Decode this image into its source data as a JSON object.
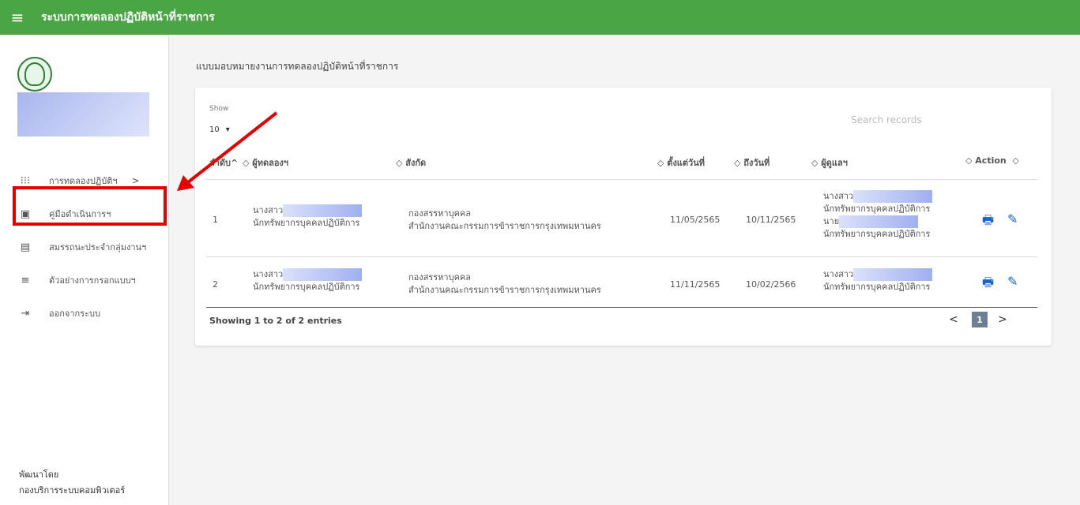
{
  "header": {
    "menu_icon": "hamburger-icon",
    "title": "ระบบการทดลองปฏิบัติหน้าที่ราชการ"
  },
  "sidebar": {
    "items": [
      {
        "label": "การทดลองปฏิบัติฯ",
        "icon": "grid-icon",
        "chevron": ">"
      },
      {
        "label": "คู่มือดำเนินการฯ",
        "icon": "wallet-icon"
      },
      {
        "label": "สมรรถนะประจำกลุ่มงานฯ",
        "icon": "document-icon"
      },
      {
        "label": "ตัวอย่างการกรอกแบบฯ",
        "icon": "list-icon"
      },
      {
        "label": "ออกจากระบบ",
        "icon": "logout-icon"
      }
    ],
    "footer": {
      "line1": "พัฒนาโดย",
      "line2": "กองบริการระบบคอมพิวเตอร์"
    }
  },
  "main": {
    "subtitle": "แบบมอบหมายงานการทดลองปฏิบัติหน้าที่ราชการ",
    "show_label": "Show",
    "show_value": "10",
    "search_placeholder": "Search records",
    "columns": [
      "ลำดับ^",
      "ผู้ทดลองฯ",
      "สังกัด",
      "ตั้งแต่วันที่",
      "ถึงวันที่",
      "ผู้ดูแลฯ",
      "Action"
    ],
    "rows": [
      {
        "no": "1",
        "trainee_prefix": "นางสาว",
        "trainee_title": "นักทรัพยากรบุคคลปฏิบัติการ",
        "dept_1": "กองสรรหาบุคคล",
        "dept_2": "สำนักงานคณะกรรมการข้าราชการกรุงเทพมหานคร",
        "from": "11/05/2565",
        "to": "10/11/2565",
        "mentors": [
          {
            "prefix": "นางสาว",
            "title": "นักทรัพยากรบุคคลปฏิบัติการ"
          },
          {
            "prefix": "นาย",
            "title": "นักทรัพยากรบุคคลปฏิบัติการ"
          }
        ]
      },
      {
        "no": "2",
        "trainee_prefix": "นางสาว",
        "trainee_title": "นักทรัพยากรบุคคลปฏิบัติการ",
        "dept_1": "กองสรรหาบุคคล",
        "dept_2": "สำนักงานคณะกรรมการข้าราชการกรุงเทพมหานคร",
        "from": "11/11/2565",
        "to": "10/02/2566",
        "mentors": [
          {
            "prefix": "นางสาว",
            "title": "นักทรัพยากรบุคคลปฏิบัติการ"
          }
        ]
      }
    ],
    "entries_text": "Showing 1 to 2 of 2 entries",
    "pagination": {
      "prev": "<",
      "current": "1",
      "next": ">"
    }
  },
  "colors": {
    "header": "#4aa544",
    "highlight": "#e60000",
    "action": "#1565c0"
  }
}
